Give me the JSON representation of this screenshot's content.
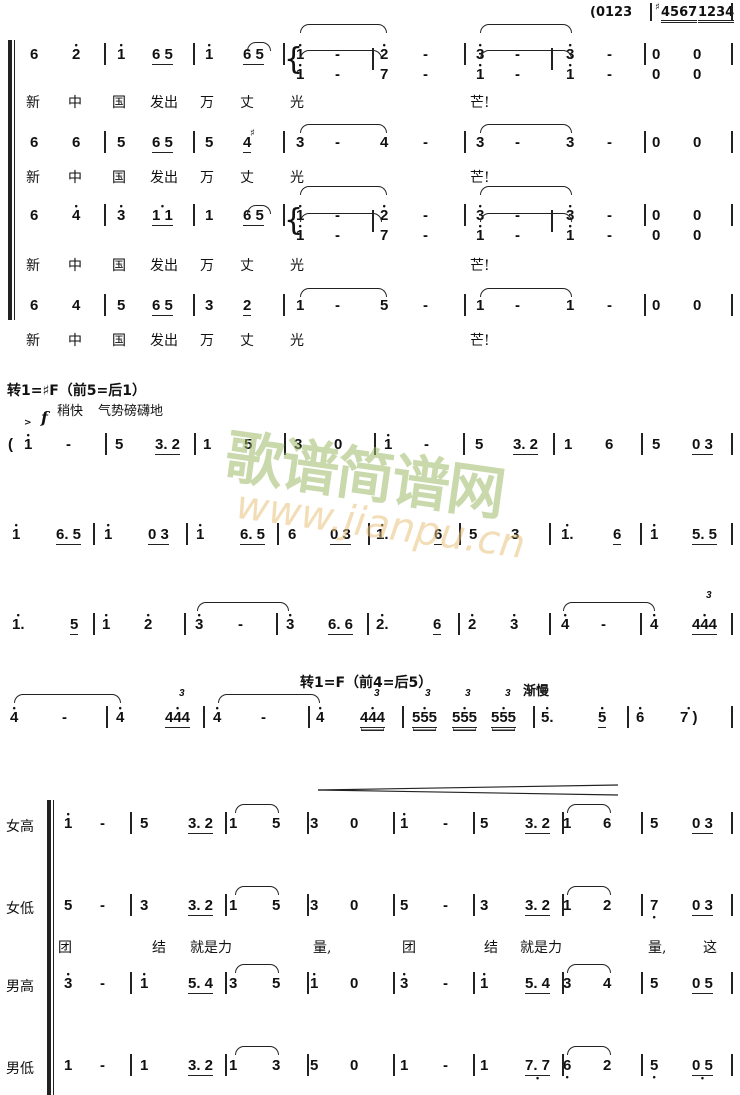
{
  "score": {
    "system1": {
      "intro": "(0123",
      "intro2": "4567",
      "intro3": "1234",
      "sharp": "♯",
      "staff1": [
        "6",
        "2",
        "1",
        "6 5",
        "1",
        "6 5",
        "1",
        "-",
        "2",
        "-",
        "3",
        "-",
        "3",
        "-",
        "0",
        "0"
      ],
      "staff1_lower": [
        "1",
        "-",
        "7",
        "-",
        "1",
        "-",
        "1",
        "-",
        "0",
        "0"
      ],
      "staff2": [
        "6",
        "6",
        "5",
        "6 5",
        "5",
        "4",
        "3",
        "-",
        "4",
        "-",
        "3",
        "-",
        "3",
        "-",
        "0",
        "0"
      ],
      "staff3": [
        "6",
        "4",
        "3",
        "1 1",
        "1",
        "6 5",
        "1",
        "-",
        "2",
        "-",
        "3",
        "-",
        "3",
        "-",
        "0",
        "0"
      ],
      "staff3_lower": [
        "1",
        "-",
        "7",
        "-",
        "1",
        "-",
        "1",
        "-",
        "0",
        "0"
      ],
      "staff4": [
        "6",
        "4",
        "5",
        "6 5",
        "3",
        "2",
        "1",
        "-",
        "5",
        "-",
        "1",
        "-",
        "1",
        "-",
        "0",
        "0"
      ],
      "lyrics": [
        "新",
        "中",
        "国",
        "发出",
        "万",
        "丈",
        "光",
        "芒!"
      ]
    },
    "key_change_1": "转1=♯F（前5=后1）",
    "tempo_1": "稍快",
    "expression_1": "气势磅礴地",
    "dynamic_1": "f",
    "row2": [
      "(",
      "1",
      "-",
      "5",
      "3. 2",
      "1",
      "5",
      "3",
      "0",
      "1",
      "-",
      "5",
      "3. 2",
      "1",
      "6",
      "5",
      "0 3"
    ],
    "row3": [
      "1",
      "6. 5",
      "1",
      "0 3",
      "1",
      "6. 5",
      "6",
      "0 3",
      "1.",
      "6",
      "5",
      "3",
      "1.",
      "6",
      "1",
      "5. 5"
    ],
    "row4": [
      "1.",
      "5",
      "1",
      "2",
      "3",
      "-",
      "3",
      "6. 6",
      "2.",
      "6",
      "2",
      "3",
      "4",
      "-",
      "4",
      "444"
    ],
    "key_change_2": "转1=F（前4=后5）",
    "tempo_2": "渐慢",
    "row5": [
      "4",
      "-",
      "4",
      "444",
      "4",
      "-",
      "4",
      "444",
      "555",
      "555",
      "555",
      "5.",
      "5",
      "6",
      "7 )"
    ],
    "triplet_mark": "3",
    "choir": {
      "parts": [
        {
          "name": "女高",
          "notes": [
            "1",
            "-",
            "5",
            "3. 2",
            "1",
            "5",
            "3",
            "0",
            "1",
            "-",
            "5",
            "3. 2",
            "1",
            "6",
            "5",
            "0 3"
          ]
        },
        {
          "name": "女低",
          "notes": [
            "5",
            "-",
            "3",
            "3. 2",
            "1",
            "5",
            "3",
            "0",
            "5",
            "-",
            "3",
            "3. 2",
            "1",
            "2",
            "7",
            "0 3"
          ]
        },
        {
          "name": "男高",
          "notes": [
            "3",
            "-",
            "1",
            "5. 4",
            "3",
            "5",
            "1",
            "0",
            "3",
            "-",
            "1",
            "5. 4",
            "3",
            "4",
            "5",
            "0 5"
          ]
        },
        {
          "name": "男低",
          "notes": [
            "1",
            "-",
            "1",
            "3. 2",
            "1",
            "3",
            "5",
            "0",
            "1",
            "-",
            "1",
            "7. 7",
            "6",
            "2",
            "5",
            "0 5"
          ]
        }
      ],
      "lyrics": [
        "团",
        "结",
        "就是力",
        "量,",
        "团",
        "结",
        "就是力",
        "量,",
        "这"
      ]
    },
    "watermark": {
      "cn": "歌谱简谱网",
      "url": "www.jianpu.cn"
    }
  }
}
